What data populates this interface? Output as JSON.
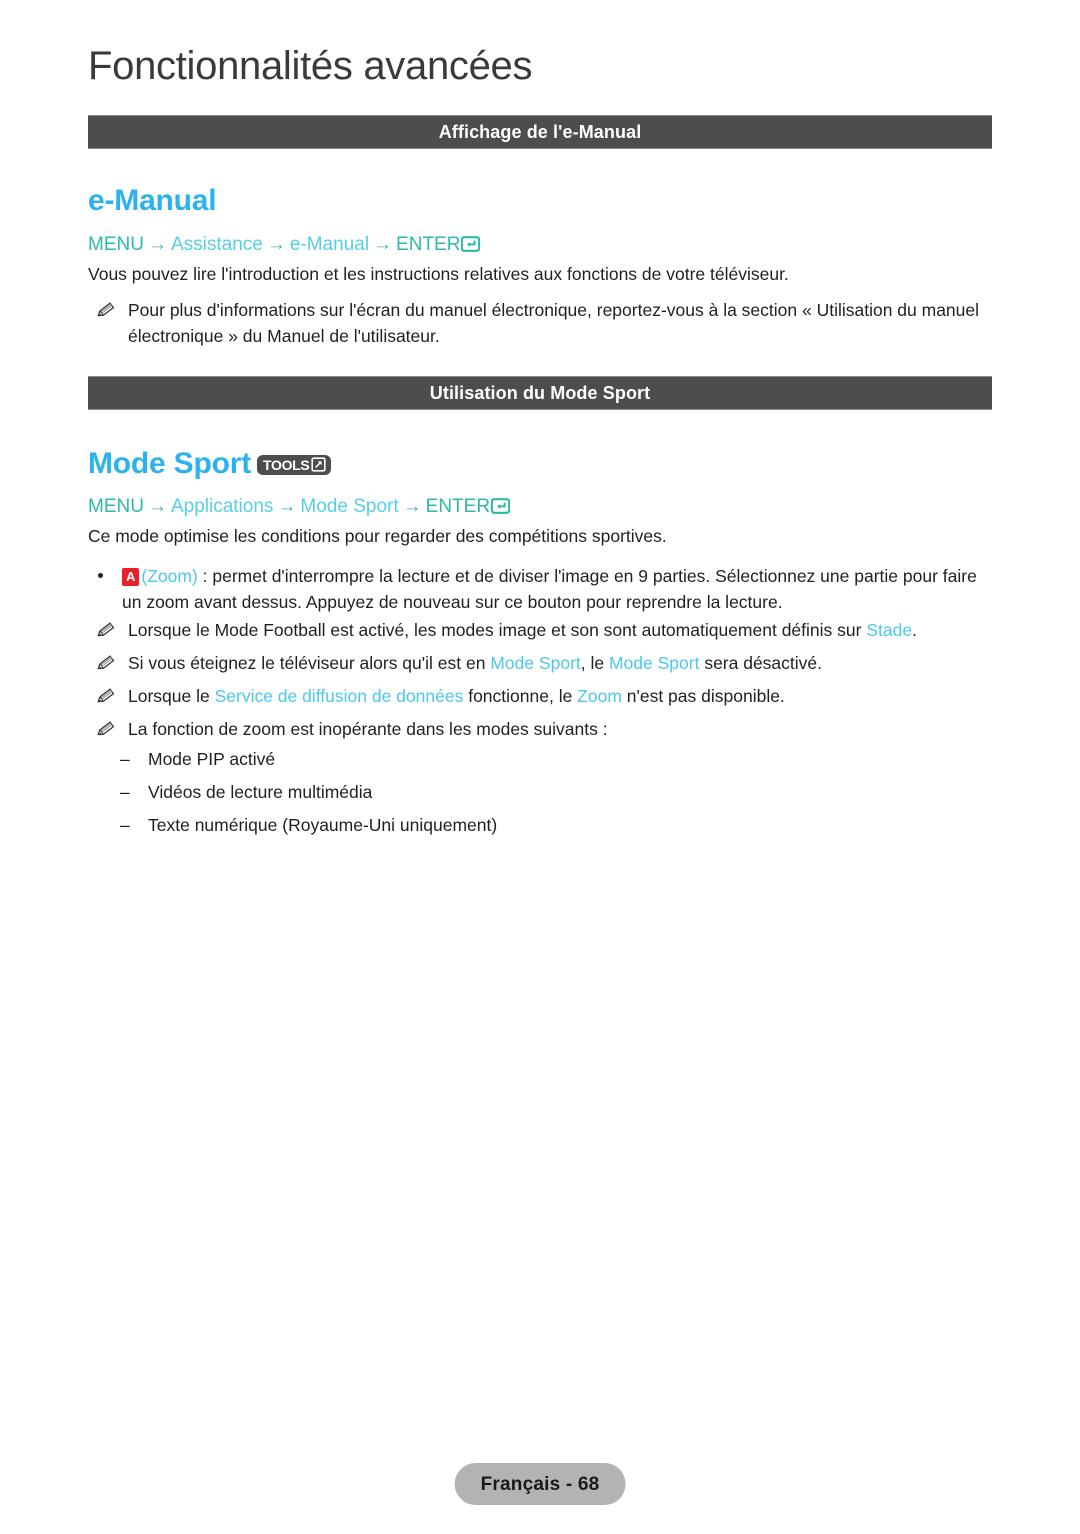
{
  "page": {
    "chapter_title": "Fonctionnalités avancées",
    "footer_label": "Français - 68",
    "colors": {
      "band_background": "#4d4d4d",
      "band_text": "#ffffff",
      "feature_heading": "#2cb2ec",
      "menu_key": "#2bbba6",
      "menu_item": "#55cfe8",
      "inline_term": "#4cc7ef",
      "key_badge_red": "#e8202a",
      "footer_pill": "#b3b3b3",
      "body_text": "#231f20"
    }
  },
  "sections": [
    {
      "band_label": "Affichage de l'e-Manual",
      "heading": "e-Manual",
      "menu_path": {
        "key": "MENU",
        "arrow": "→",
        "items": [
          "Assistance",
          "e-Manual"
        ],
        "enter_label": "ENTER",
        "enter_icon": "enter-arrow-icon"
      },
      "intro": "Vous pouvez lire l'introduction et les instructions relatives aux fonctions de votre téléviseur.",
      "note": {
        "icon": "pencil-note-icon",
        "text": "Pour plus d'informations sur l'écran du manuel électronique, reportez-vous à la section « Utilisation du manuel électronique » du Manuel de l'utilisateur."
      }
    },
    {
      "band_label": "Utilisation du Mode Sport",
      "heading": "Mode Sport",
      "tools_badge": {
        "label": "TOOLS",
        "icon": "tools-arrow-icon"
      },
      "menu_path": {
        "key": "MENU",
        "arrow": "→",
        "items": [
          "Applications",
          "Mode Sport"
        ],
        "enter_label": "ENTER",
        "enter_icon": "enter-arrow-icon"
      },
      "intro": "Ce mode optimise les conditions pour regarder des compétitions sportives.",
      "bullet": {
        "key_badge": "A",
        "term": "(Zoom)",
        "text": " : permet d'interrompre la lecture et de diviser l'image en 9 parties. Sélectionnez une partie pour faire un zoom avant dessus. Appuyez de nouveau sur ce bouton pour reprendre la lecture."
      },
      "notes": [
        {
          "icon": "pencil-note-icon",
          "parts": [
            {
              "text": "Lorsque le Mode Football est activé, les modes image et son sont automatiquement définis sur ",
              "style": "plain"
            },
            {
              "text": "Stade",
              "style": "term"
            },
            {
              "text": ".",
              "style": "plain"
            }
          ]
        },
        {
          "icon": "pencil-note-icon",
          "parts": [
            {
              "text": "Si vous éteignez le téléviseur alors qu'il est en ",
              "style": "plain"
            },
            {
              "text": "Mode Sport",
              "style": "term"
            },
            {
              "text": ", le ",
              "style": "plain"
            },
            {
              "text": "Mode Sport",
              "style": "term"
            },
            {
              "text": " sera désactivé.",
              "style": "plain"
            }
          ]
        },
        {
          "icon": "pencil-note-icon",
          "parts": [
            {
              "text": "Lorsque le ",
              "style": "plain"
            },
            {
              "text": "Service de diffusion de données",
              "style": "term"
            },
            {
              "text": " fonctionne, le ",
              "style": "plain"
            },
            {
              "text": "Zoom",
              "style": "term"
            },
            {
              "text": " n'est pas disponible.",
              "style": "plain"
            }
          ]
        },
        {
          "icon": "pencil-note-icon",
          "parts": [
            {
              "text": "La fonction de zoom est inopérante dans les modes suivants :",
              "style": "plain"
            }
          ]
        }
      ],
      "sub_items": [
        {
          "dash": "–",
          "text": "Mode PIP activé"
        },
        {
          "dash": "–",
          "text": "Vidéos de lecture multimédia"
        },
        {
          "dash": "–",
          "text": "Texte numérique (Royaume-Uni uniquement)"
        }
      ]
    }
  ]
}
